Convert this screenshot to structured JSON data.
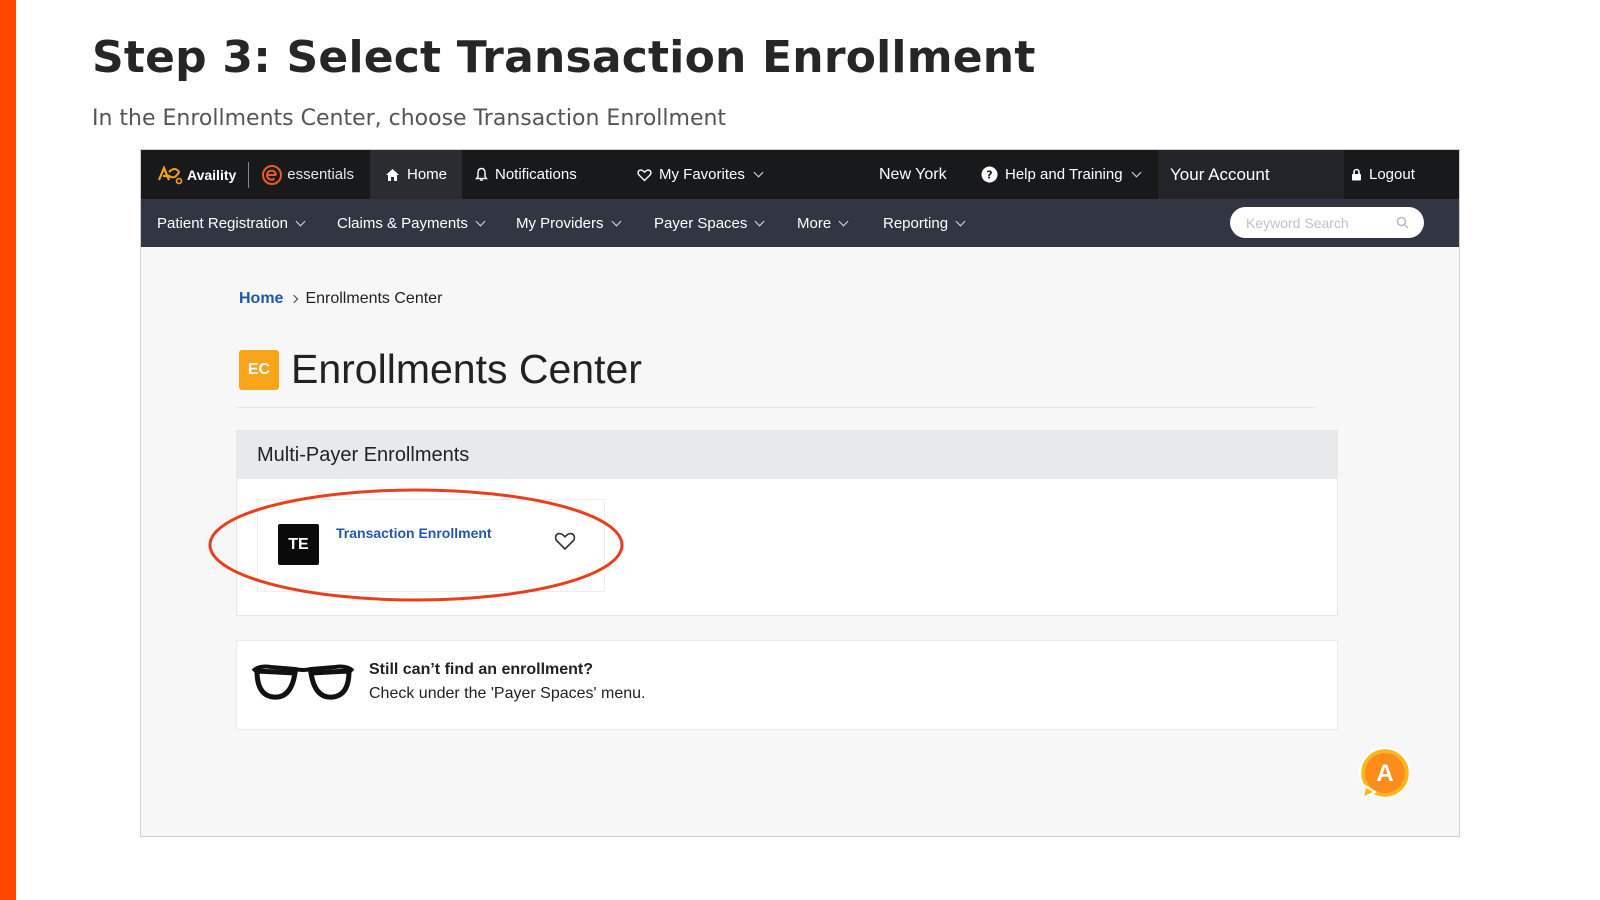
{
  "slide": {
    "title": "Step 3: Select Transaction Enrollment",
    "subtitle": "In the Enrollments Center, choose Transaction Enrollment"
  },
  "colors": {
    "accent": "#ff4500",
    "topbar": "#18191b",
    "navbar": "#323642",
    "link": "#2159a8",
    "badge_ec": "#f8a519",
    "highlight_ring": "#e8401c"
  },
  "topbar": {
    "brand_availity": "Availity",
    "brand_essentials": "essentials",
    "home": "Home",
    "notifications": "Notifications",
    "favorites": "My Favorites",
    "location": "New York",
    "help": "Help and Training",
    "account": "Your Account",
    "logout": "Logout"
  },
  "navbar": {
    "items": [
      "Patient Registration",
      "Claims & Payments",
      "My Providers",
      "Payer Spaces",
      "More",
      "Reporting"
    ],
    "search_placeholder": "Keyword Search"
  },
  "breadcrumb": {
    "home": "Home",
    "current": "Enrollments Center"
  },
  "page": {
    "badge": "EC",
    "title": "Enrollments Center"
  },
  "panel": {
    "title": "Multi-Payer Enrollments",
    "card": {
      "badge": "TE",
      "title": "Transaction Enrollment"
    }
  },
  "tip": {
    "title": "Still can’t find an enrollment?",
    "text": "Check under the 'Payer Spaces' menu."
  },
  "assistant": {
    "label": "A"
  },
  "icons": [
    "availity-logo-icon",
    "essentials-logo-icon",
    "home-icon",
    "bell-icon",
    "heart-icon",
    "help-circle-icon",
    "lock-icon",
    "search-icon",
    "chevron-down-icon",
    "chevron-right-icon",
    "glasses-icon",
    "chat-bubble-icon"
  ]
}
